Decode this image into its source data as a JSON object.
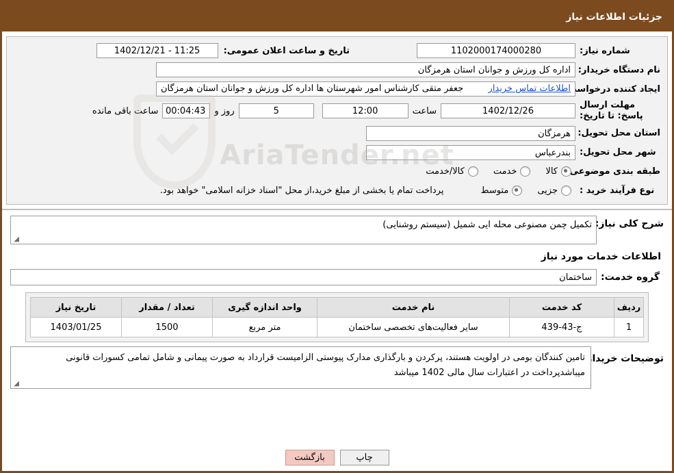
{
  "header": {
    "title": "جزئیات اطلاعات نیاز"
  },
  "info": {
    "need_number_label": "شماره نیاز:",
    "need_number_value": "1102000174000280",
    "announce_datetime_label": "تاریخ و ساعت اعلان عمومی:",
    "announce_datetime_value": "11:25 - 1402/12/21",
    "buyer_org_label": "نام دستگاه خریدار:",
    "buyer_org_value": "اداره کل ورزش و جوانان استان هرمزگان",
    "requester_label": "ایجاد کننده درخواست:",
    "requester_value": "جعفر متقی کارشناس امور شهرستان ها اداره کل ورزش و جوانان استان هرمزگان",
    "contact_link": "اطلاعات تماس خریدار",
    "deadline_label": "مهلت ارسال پاسخ: تا تاریخ:",
    "deadline_date": "1402/12/26",
    "hour_label": "ساعت",
    "deadline_time": "12:00",
    "days_value": "5",
    "days_label": "روز و",
    "remaining_value": "00:04:43",
    "remaining_label": "ساعت باقی مانده",
    "province_label": "استان محل تحویل:",
    "province_value": "هرمزگان",
    "city_label": "شهر محل تحویل:",
    "city_value": "بندرعباس",
    "category_label": "طبقه بندی موضوعی:",
    "category_options": [
      {
        "label": "کالا",
        "checked": true
      },
      {
        "label": "خدمت",
        "checked": false
      },
      {
        "label": "کالا/خدمت",
        "checked": false
      }
    ],
    "purchase_type_label": "نوع فرآیند خرید :",
    "purchase_type_options": [
      {
        "label": "جزیی",
        "checked": false
      },
      {
        "label": "متوسط",
        "checked": true
      }
    ],
    "purchase_note": "پرداخت تمام یا بخشی از مبلغ خرید،از محل \"اسناد خزانه اسلامی\" خواهد بود."
  },
  "watermark": {
    "text": "AriaTender.net"
  },
  "middle": {
    "summary_label": "شرح کلی نیاز:",
    "summary_value": "تکمیل چمن مصنوعی محله ایی شمیل (سیستم روشنایی)",
    "services_info_title": "اطلاعات خدمات مورد نیاز",
    "service_group_label": "گروه خدمت:",
    "service_group_value": "ساختمان"
  },
  "table": {
    "headers": [
      "ردیف",
      "کد خدمت",
      "نام خدمت",
      "واحد اندازه گیری",
      "تعداد / مقدار",
      "تاریخ نیاز"
    ],
    "rows": [
      {
        "row": "1",
        "code": "ج-43-439",
        "name": "سایر فعالیت‌های تخصصی ساختمان",
        "unit": "متر مربع",
        "qty": "1500",
        "date": "1403/01/25"
      }
    ]
  },
  "buyer_notes": {
    "label": "توضیحات خریدار:",
    "text": "تامین کنندگان بومی در اولویت هستند، پرکردن و بارگذاری مدارک پیوستی الزامیست   قرارداد به صورت پیمانی و شامل تمامی کسورات قانونی میباشدپرداخت در اعتبارات سال مالی 1402 میباشد"
  },
  "footer": {
    "print_label": "چاپ",
    "back_label": "بازگشت"
  }
}
